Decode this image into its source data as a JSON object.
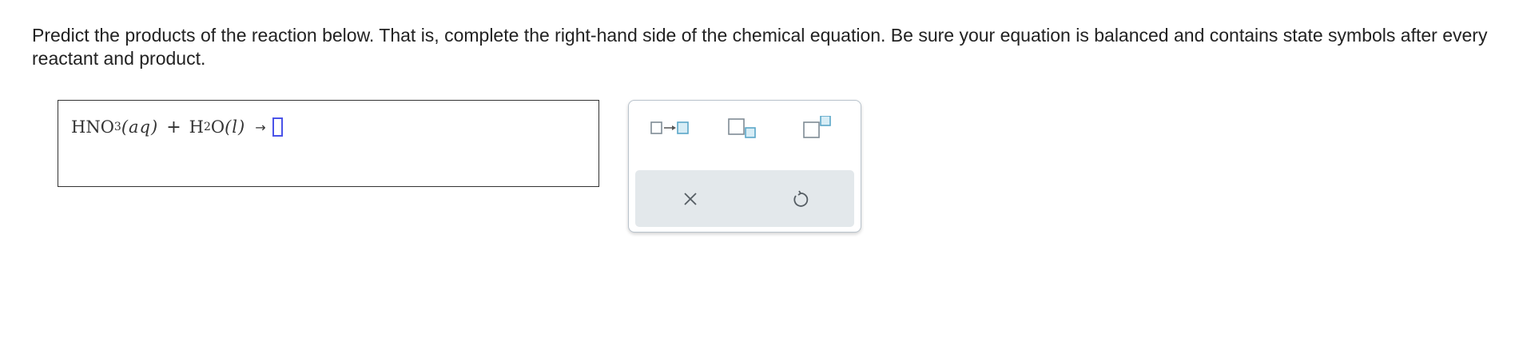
{
  "prompt": {
    "text": "Predict the products of the reaction below. That is, complete the right-hand side of the chemical equation. Be sure your equation is balanced and contains state symbols after every reactant and product."
  },
  "equation": {
    "reactant1_formula": "HNO",
    "reactant1_subscript": "3",
    "reactant1_state": "(aq)",
    "plus": "+",
    "reactant2_formula_a": "H",
    "reactant2_subscript": "2",
    "reactant2_formula_b": "O",
    "reactant2_state": "(l)",
    "arrow": "→"
  },
  "toolbar": {
    "buttons": [
      "arrow-template-icon",
      "subscript-template-icon",
      "superscript-template-icon"
    ],
    "actions": [
      "clear-icon",
      "undo-icon"
    ]
  },
  "colors": {
    "placeholder_border": "#4a53e8",
    "template_accent": "#5aa6c8",
    "template_box": "#7f8b94",
    "action_bar_bg": "#e3e8eb"
  }
}
